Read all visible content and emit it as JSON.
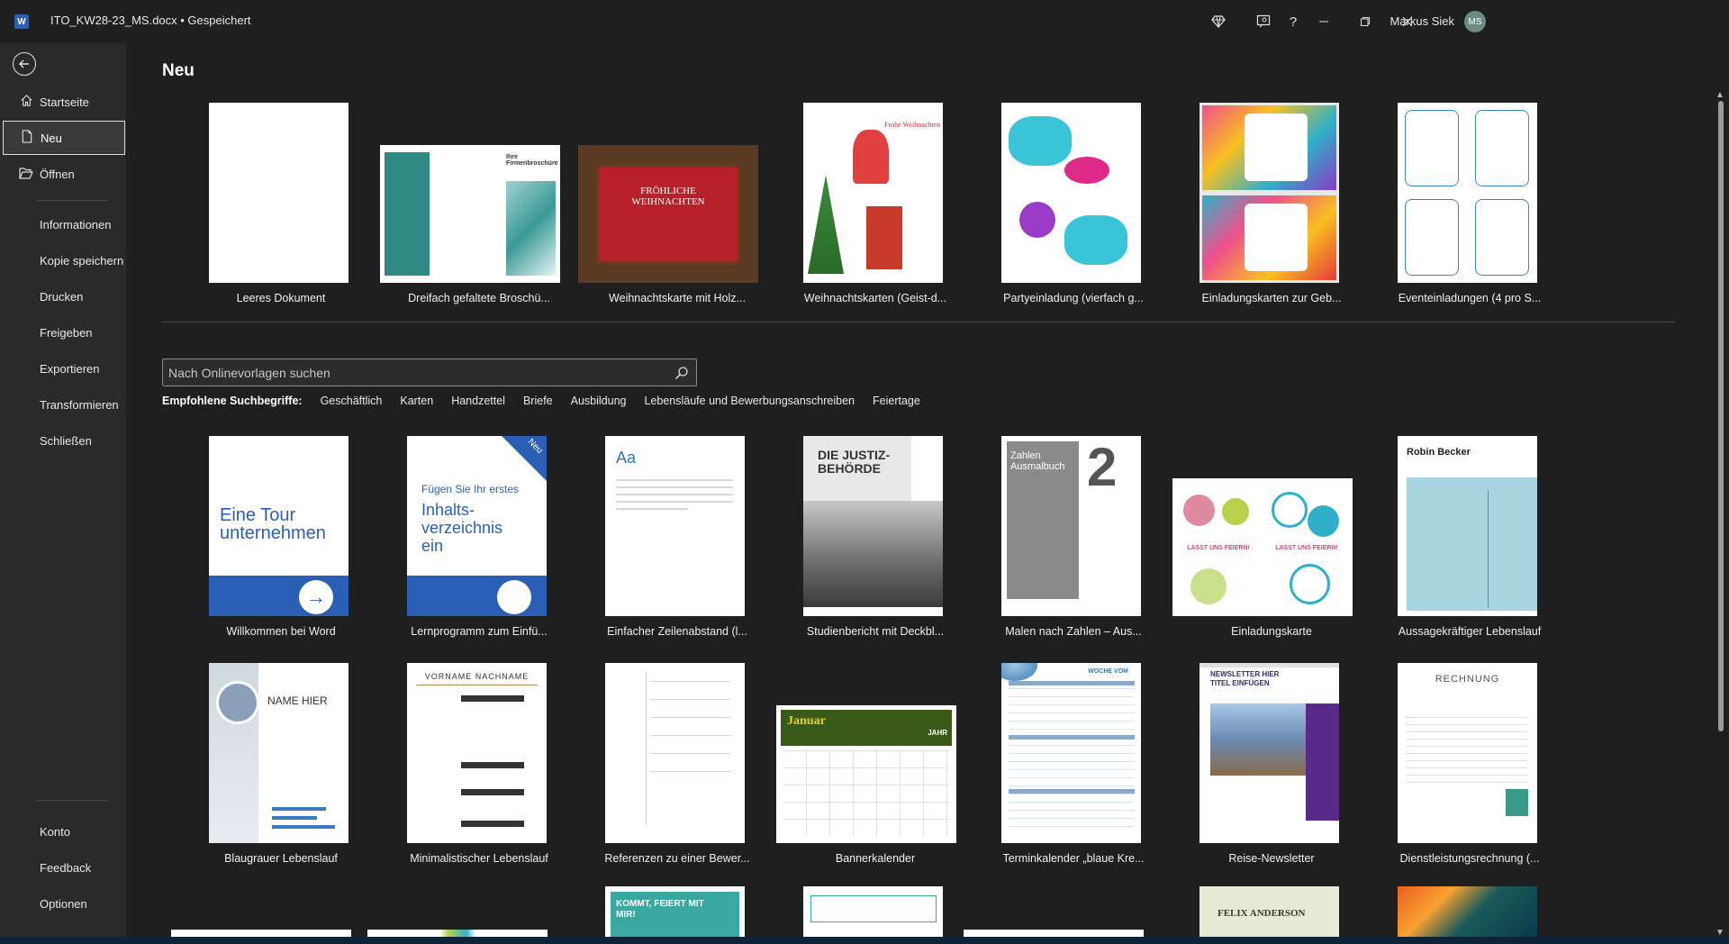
{
  "titlebar": {
    "doc_title": "ITO_KW28-23_MS.docx • Gespeichert",
    "user_name": "Markus Siek",
    "avatar_initials": "MS",
    "help": "?"
  },
  "nav": {
    "items": [
      {
        "label": "Startseite"
      },
      {
        "label": "Neu"
      },
      {
        "label": "Öffnen"
      },
      {
        "label": "Informationen"
      },
      {
        "label": "Kopie speichern"
      },
      {
        "label": "Drucken"
      },
      {
        "label": "Freigeben"
      },
      {
        "label": "Exportieren"
      },
      {
        "label": "Transformieren"
      },
      {
        "label": "Schließen"
      }
    ],
    "bottom": [
      {
        "label": "Konto"
      },
      {
        "label": "Feedback"
      },
      {
        "label": "Optionen"
      }
    ]
  },
  "main": {
    "title": "Neu",
    "featured": [
      {
        "label": "Leeres Dokument"
      },
      {
        "label": "Dreifach gefaltete Broschü..."
      },
      {
        "label": "Weihnachtskarte mit Holz..."
      },
      {
        "label": "Weihnachtskarten (Geist-d..."
      },
      {
        "label": "Partyeinladung (vierfach g..."
      },
      {
        "label": "Einladungskarten zur Geb..."
      },
      {
        "label": "Eventeinladungen (4 pro S..."
      }
    ],
    "search": {
      "placeholder": "Nach Onlinevorlagen suchen"
    },
    "suggested": {
      "lead": "Empfohlene Suchbegriffe:",
      "terms": [
        "Geschäftlich",
        "Karten",
        "Handzettel",
        "Briefe",
        "Ausbildung",
        "Lebensläufe und Bewerbungsanschreiben",
        "Feiertage"
      ]
    },
    "row1": [
      {
        "label": "Willkommen bei Word",
        "thumb_text": "Eine Tour unternehmen"
      },
      {
        "label": "Lernprogramm zum Einfü...",
        "thumb_text": "Fügen Sie Ihr erstes",
        "thumb_big": "Inhalts-verzeichnis ein",
        "badge": "Neu"
      },
      {
        "label": "Einfacher Zeilenabstand (l...",
        "thumb_text": "Aa"
      },
      {
        "label": "Studienbericht mit Deckbl...",
        "thumb_text": "DIE JUSTIZ-BEHÖRDE"
      },
      {
        "label": "Malen nach Zahlen – Aus...",
        "thumb_text": "Zahlen Ausmalbuch",
        "thumb_num": "2"
      },
      {
        "label": "Einladungskarte",
        "thumb_text": "LASST UNS FEIERN!"
      },
      {
        "label": "Aussagekräftiger Lebenslauf",
        "thumb_text": "Robin Becker"
      }
    ],
    "row2": [
      {
        "label": "Blaugrauer Lebenslauf",
        "thumb_text": "NAME HIER"
      },
      {
        "label": "Minimalistischer Lebenslauf",
        "thumb_text": "VORNAME NACHNAME"
      },
      {
        "label": "Referenzen zu einer Bewer..."
      },
      {
        "label": "Bannerkalender",
        "thumb_text": "Januar",
        "thumb_sub": "JAHR"
      },
      {
        "label": "Terminkalender „blaue Kre...",
        "thumb_text": "WOCHE VOM"
      },
      {
        "label": "Reise-Newsletter",
        "thumb_text": "NEWSLETTER HIER TITEL EINFÜGEN"
      },
      {
        "label": "Dienstleistungsrechnung (...",
        "thumb_text": "RECHNUNG"
      }
    ],
    "row3": [
      {
        "thumb_text": "KOMMT, FEIERT MIT MIR!"
      },
      {
        "thumb_text": "FELIX ANDERSON"
      }
    ]
  }
}
